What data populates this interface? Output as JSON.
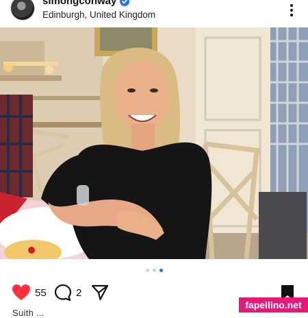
{
  "post": {
    "username": "simongconway",
    "location": "Edinburgh, United Kingdom",
    "likes_count": "55",
    "comments_count": "2",
    "carousel": {
      "total": 3,
      "active_index": 2
    },
    "caption_preview": "Suith ..."
  },
  "watermark": "fapellino.net",
  "colors": {
    "like_red": "#ff3040",
    "verified_blue": "#1877f2",
    "watermark_pink": "#e6197a"
  },
  "icons": [
    "more-vertical-icon",
    "verified-badge-icon",
    "heart-icon",
    "comment-icon",
    "share-icon",
    "bookmark-icon"
  ]
}
